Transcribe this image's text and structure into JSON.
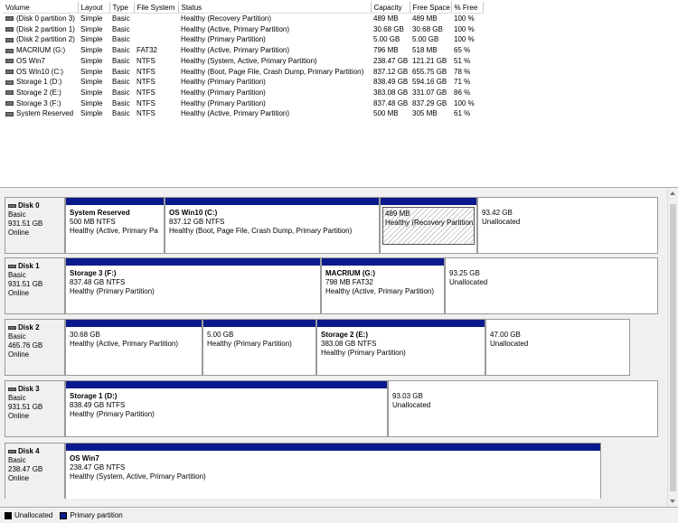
{
  "volumes": {
    "headers": [
      "Volume",
      "Layout",
      "Type",
      "File System",
      "Status",
      "Capacity",
      "Free Space",
      "% Free"
    ],
    "rows": [
      [
        "(Disk 0 partition 3)",
        "Simple",
        "Basic",
        "",
        "Healthy (Recovery Partition)",
        "489 MB",
        "489 MB",
        "100 %"
      ],
      [
        "(Disk 2 partition 1)",
        "Simple",
        "Basic",
        "",
        "Healthy (Active, Primary Partition)",
        "30.68 GB",
        "30.68 GB",
        "100 %"
      ],
      [
        "(Disk 2 partition 2)",
        "Simple",
        "Basic",
        "",
        "Healthy (Primary Partition)",
        "5.00 GB",
        "5.00 GB",
        "100 %"
      ],
      [
        "MACRIUM (G:)",
        "Simple",
        "Basic",
        "FAT32",
        "Healthy (Active, Primary Partition)",
        "796 MB",
        "518 MB",
        "65 %"
      ],
      [
        "OS Win7",
        "Simple",
        "Basic",
        "NTFS",
        "Healthy (System, Active, Primary Partition)",
        "238.47 GB",
        "121.21 GB",
        "51 %"
      ],
      [
        "OS Win10 (C:)",
        "Simple",
        "Basic",
        "NTFS",
        "Healthy (Boot, Page File, Crash Dump, Primary Partition)",
        "837.12 GB",
        "655.75 GB",
        "78 %"
      ],
      [
        "Storage 1 (D:)",
        "Simple",
        "Basic",
        "NTFS",
        "Healthy (Primary Partition)",
        "838.49 GB",
        "594.16 GB",
        "71 %"
      ],
      [
        "Storage 2 (E:)",
        "Simple",
        "Basic",
        "NTFS",
        "Healthy (Primary Partition)",
        "383.08 GB",
        "331.07 GB",
        "86 %"
      ],
      [
        "Storage 3 (F:)",
        "Simple",
        "Basic",
        "NTFS",
        "Healthy (Primary Partition)",
        "837.48 GB",
        "837.29 GB",
        "100 %"
      ],
      [
        "System Reserved",
        "Simple",
        "Basic",
        "NTFS",
        "Healthy (Active, Primary Partition)",
        "500 MB",
        "305 MB",
        "61 %"
      ]
    ]
  },
  "disks": [
    {
      "name": "Disk 0",
      "type": "Basic",
      "size": "931.51 GB",
      "state": "Online",
      "partitions": [
        {
          "kind": "primary",
          "title": "System Reserved",
          "size": "500 MB NTFS",
          "status": "Healthy (Active, Primary Pa"
        },
        {
          "kind": "primary",
          "title": "OS Win10  (C:)",
          "size": "837.12 GB NTFS",
          "status": "Healthy (Boot, Page File, Crash Dump, Primary Partition)"
        },
        {
          "kind": "primary",
          "title": "",
          "size": "489 MB",
          "status": "Healthy (Recovery Partition",
          "selected": true
        },
        {
          "kind": "unallocated",
          "title": "",
          "size": "93.42 GB",
          "status": "Unallocated"
        }
      ]
    },
    {
      "name": "Disk 1",
      "type": "Basic",
      "size": "931.51 GB",
      "state": "Online",
      "partitions": [
        {
          "kind": "primary",
          "title": "Storage 3  (F:)",
          "size": "837.48 GB NTFS",
          "status": "Healthy (Primary Partition)"
        },
        {
          "kind": "primary",
          "title": "MACRIUM  (G:)",
          "size": "798 MB FAT32",
          "status": "Healthy (Active, Primary Partition)"
        },
        {
          "kind": "unallocated",
          "title": "",
          "size": "93.25 GB",
          "status": "Unallocated"
        }
      ]
    },
    {
      "name": "Disk 2",
      "type": "Basic",
      "size": "465.76 GB",
      "state": "Online",
      "partitions": [
        {
          "kind": "primary",
          "title": "",
          "size": "30.68 GB",
          "status": "Healthy (Active, Primary Partition)"
        },
        {
          "kind": "primary",
          "title": "",
          "size": "5.00 GB",
          "status": "Healthy (Primary Partition)"
        },
        {
          "kind": "primary",
          "title": "Storage 2  (E:)",
          "size": "383.08 GB NTFS",
          "status": "Healthy (Primary Partition)"
        },
        {
          "kind": "unallocated",
          "title": "",
          "size": "47.00 GB",
          "status": "Unallocated"
        }
      ]
    },
    {
      "name": "Disk 3",
      "type": "Basic",
      "size": "931.51 GB",
      "state": "Online",
      "partitions": [
        {
          "kind": "primary",
          "title": "Storage 1  (D:)",
          "size": "838.49 GB NTFS",
          "status": "Healthy (Primary Partition)"
        },
        {
          "kind": "unallocated",
          "title": "",
          "size": "93.03 GB",
          "status": "Unallocated"
        }
      ]
    },
    {
      "name": "Disk 4",
      "type": "Basic",
      "size": "238.47 GB",
      "state": "Online",
      "partitions": [
        {
          "kind": "primary",
          "title": "OS Win7",
          "size": "238.47 GB NTFS",
          "status": "Healthy (System, Active, Primary Partition)"
        }
      ]
    }
  ],
  "legend": {
    "unallocated": "Unallocated",
    "primary": "Primary partition",
    "unallocated_color": "#000000",
    "primary_color": "#0a1a8c"
  },
  "icons": {
    "volume": "drive-icon",
    "disk": "disk-icon"
  }
}
